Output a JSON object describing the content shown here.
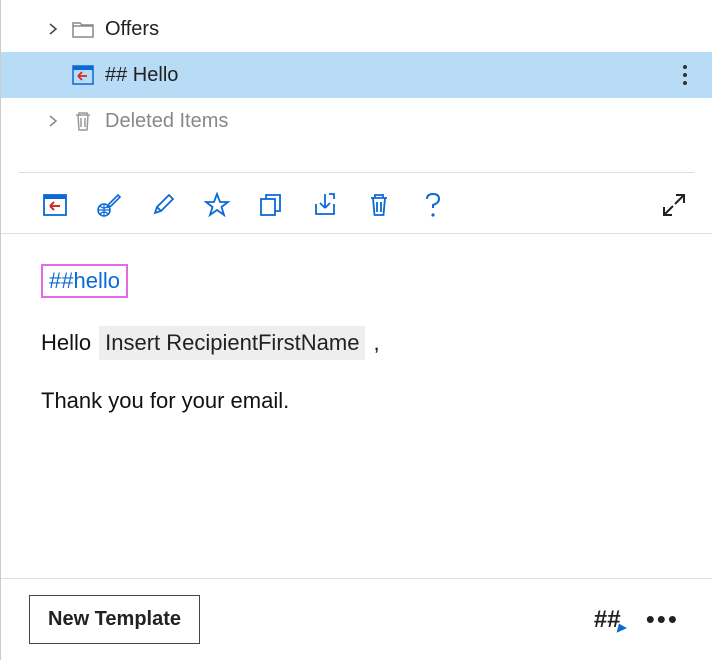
{
  "tree": {
    "items": [
      {
        "label": "Offers",
        "type": "folder",
        "selected": false,
        "muted": false
      },
      {
        "label": "## Hello",
        "type": "template",
        "selected": true,
        "muted": false
      },
      {
        "label": "Deleted Items",
        "type": "trash",
        "selected": false,
        "muted": true
      }
    ]
  },
  "editor": {
    "shortcut": "##hello",
    "greeting_prefix": "Hello",
    "placeholder_name": "Insert RecipientFirstName",
    "greeting_suffix": ",",
    "body_line": "Thank you for your email."
  },
  "footer": {
    "new_template_label": "New Template"
  },
  "colors": {
    "accent": "#0b6ad4",
    "selection": "#b8dcf5",
    "highlight_border": "#e36be3"
  }
}
